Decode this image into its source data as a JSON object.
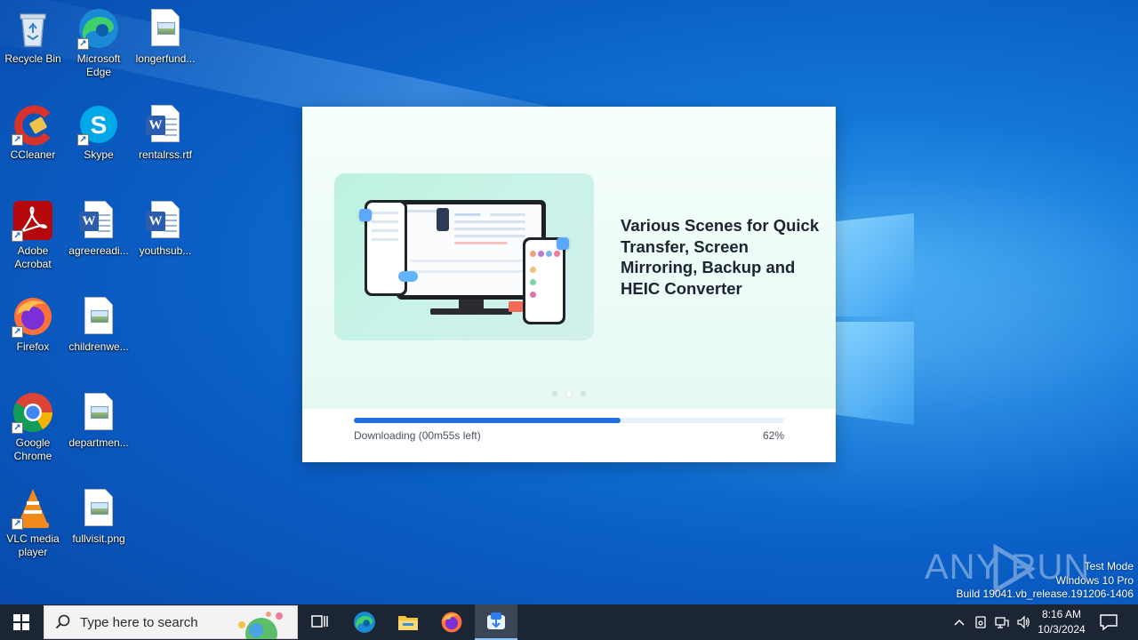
{
  "desktop": {
    "icons": [
      {
        "label": "Recycle Bin",
        "icon": "recycle-bin-icon"
      },
      {
        "label": "Microsoft Edge",
        "icon": "edge-icon"
      },
      {
        "label": "longerfund...",
        "icon": "image-file-icon"
      },
      {
        "label": "CCleaner",
        "icon": "ccleaner-icon"
      },
      {
        "label": "Skype",
        "icon": "skype-icon"
      },
      {
        "label": "rentalrss.rtf",
        "icon": "word-document-icon"
      },
      {
        "label": "Adobe Acrobat",
        "icon": "acrobat-icon"
      },
      {
        "label": "agreereadi...",
        "icon": "word-document-icon"
      },
      {
        "label": "youthsub...",
        "icon": "word-document-icon"
      },
      {
        "label": "Firefox",
        "icon": "firefox-icon"
      },
      {
        "label": "childrenwe...",
        "icon": "image-file-icon"
      },
      {
        "label": "Google Chrome",
        "icon": "chrome-icon"
      },
      {
        "label": "departmen...",
        "icon": "image-file-icon"
      },
      {
        "label": "VLC media player",
        "icon": "vlc-icon"
      },
      {
        "label": "fullvisit.png",
        "icon": "image-file-icon"
      }
    ]
  },
  "installer": {
    "headline": "Various Scenes for Quick Transfer, Screen Mirroring, Backup and HEIC Converter",
    "status_text": "Downloading (00m55s left)",
    "percent_text": "62%",
    "progress": 0.62,
    "slides_total": 3,
    "active_slide": 2,
    "accent_color": "#1f6fe0"
  },
  "watermark": {
    "brand": "ANY RUN"
  },
  "system_info": {
    "line1": "Test Mode",
    "line2": "Windows 10 Pro",
    "line3": "Build 19041.vb_release.191206-1406"
  },
  "taskbar": {
    "search_placeholder": "Type here to search",
    "apps": [
      "task-view-icon",
      "edge-icon",
      "file-explorer-icon",
      "firefox-icon",
      "installer-app-icon"
    ],
    "clock_time": "8:16 AM",
    "clock_date": "10/3/2024"
  }
}
